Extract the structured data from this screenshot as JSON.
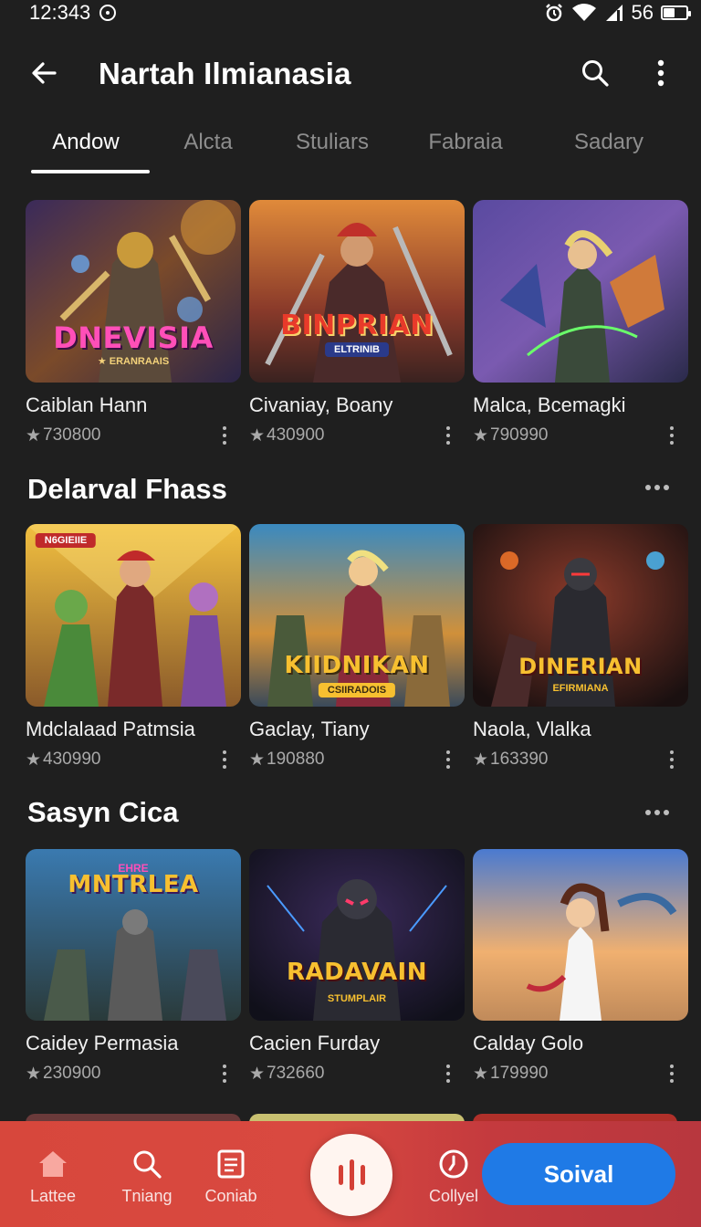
{
  "status": {
    "time": "12:343",
    "battery": "56"
  },
  "header": {
    "title": "Nartah Ilmianasia"
  },
  "tabs": [
    "Andow",
    "Alcta",
    "Stuliars",
    "Fabraia",
    "Sadary"
  ],
  "sections": [
    {
      "title": "",
      "cards": [
        {
          "name": "Caiblan Hann",
          "rating": "730800",
          "art_title": "DNEVISIA",
          "art_sub": "★ ERANRAAIS"
        },
        {
          "name": "Civaniay, Boany",
          "rating": "430900",
          "art_title": "BINPRIAN",
          "art_sub": "ELTRINIB"
        },
        {
          "name": "Malca, Bcemagki",
          "rating": "790990",
          "art_title": "",
          "art_sub": ""
        }
      ]
    },
    {
      "title": "Delarval Fhass",
      "cards": [
        {
          "name": "Mdclalaad Patmsia",
          "rating": "430990",
          "art_title": "",
          "art_sub": "N6GIEIIE"
        },
        {
          "name": "Gaclay, Tiany",
          "rating": "190880",
          "art_title": "KIIDNIKAN",
          "art_sub": "CSIIRADOIS"
        },
        {
          "name": "Naola, Vlalka",
          "rating": "163390",
          "art_title": "DINERIAN",
          "art_sub": "EFIRMIANA"
        }
      ]
    },
    {
      "title": "Sasyn Cica",
      "cards": [
        {
          "name": "Caidey Permasia",
          "rating": "230900",
          "art_title": "MNTRLEA",
          "art_sub": "EHRE"
        },
        {
          "name": "Cacien Furday",
          "rating": "732660",
          "art_title": "RADAVAIN",
          "art_sub": "STUMPLAIR"
        },
        {
          "name": "Calday Golo",
          "rating": "179990",
          "art_title": "",
          "art_sub": ""
        }
      ]
    }
  ],
  "bottom_nav": {
    "items": [
      {
        "label": "Lattee",
        "icon": "home-icon"
      },
      {
        "label": "Tniang",
        "icon": "search-icon"
      },
      {
        "label": "Coniab",
        "icon": "document-icon"
      },
      {
        "label": "Collyel",
        "icon": "clock-icon"
      }
    ],
    "fab_icon": "equalizer-icon",
    "cta_label": "Soival"
  },
  "colors": {
    "accent": "#1f7ae6",
    "nav_bg": "#d7473c",
    "background": "#1f1f1f"
  }
}
